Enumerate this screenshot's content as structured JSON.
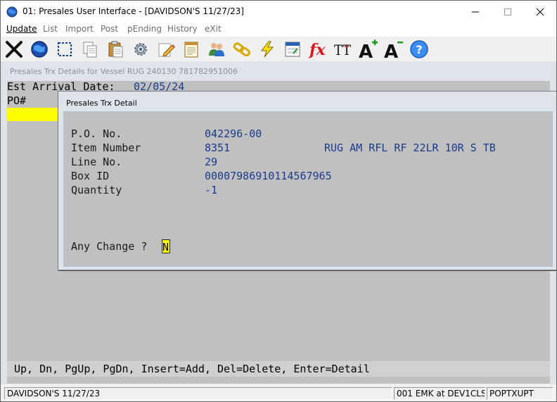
{
  "window": {
    "title": "01: Presales User Interface - [DAVIDSON'S 11/27/23]"
  },
  "menu": [
    {
      "label": "Update",
      "active": true
    },
    {
      "label": "List",
      "active": false
    },
    {
      "label": "Import",
      "active": false
    },
    {
      "label": "Post",
      "active": false
    },
    {
      "label": "pEnding",
      "active": false
    },
    {
      "label": "History",
      "active": false
    },
    {
      "label": "eXit",
      "active": false
    }
  ],
  "toolbar": {
    "icons": [
      "close-x-icon",
      "globe-icon",
      "select-rectangle-icon",
      "copy-icon",
      "paste-icon",
      "settings-gear-icon",
      "edit-pencil-icon",
      "notepad-icon",
      "users-icon",
      "link-chain-icon",
      "lightning-icon",
      "calculator-icon",
      "function-fx-icon",
      "font-size-icon",
      "increase-font-icon",
      "decrease-font-icon",
      "help-icon"
    ],
    "fx_glyph": "fx",
    "tt_glyph": "TT",
    "a_glyph": "A",
    "help_glyph": "?"
  },
  "child": {
    "title": "Presales Trx Details for Vessel  RUG 240130 781782951006",
    "arrival_label": "Est Arrival Date:",
    "arrival_value": "02/05/24",
    "po_header": "PO#",
    "help_line": "Up, Dn, PgUp, PgDn, Insert=Add, Del=Delete, Enter=Detail"
  },
  "dialog": {
    "title": "Presales Trx Detail",
    "fields": [
      {
        "label": "P.O. No.",
        "value": "042296-00",
        "desc": ""
      },
      {
        "label": "Item Number",
        "value": "8351",
        "desc": "RUG AM RFL RF 22LR 10R S TB"
      },
      {
        "label": "Line No.",
        "value": "29",
        "desc": ""
      },
      {
        "label": "Box ID",
        "value": "00007986910114567965",
        "desc": ""
      },
      {
        "label": "Quantity",
        "value": "-1",
        "desc": ""
      }
    ],
    "prompt": "Any Change ?",
    "prompt_value": "N"
  },
  "statusbar": {
    "panel1": "DAVIDSON'S 11/27/23",
    "panel2": "",
    "panel3": "001 EMK at DEV1CLS",
    "panel4": "POPTXUPT"
  },
  "colors": {
    "highlight": "#ffff00",
    "value_text": "#1a3a8a",
    "screen_bg": "#c0c0c0"
  }
}
